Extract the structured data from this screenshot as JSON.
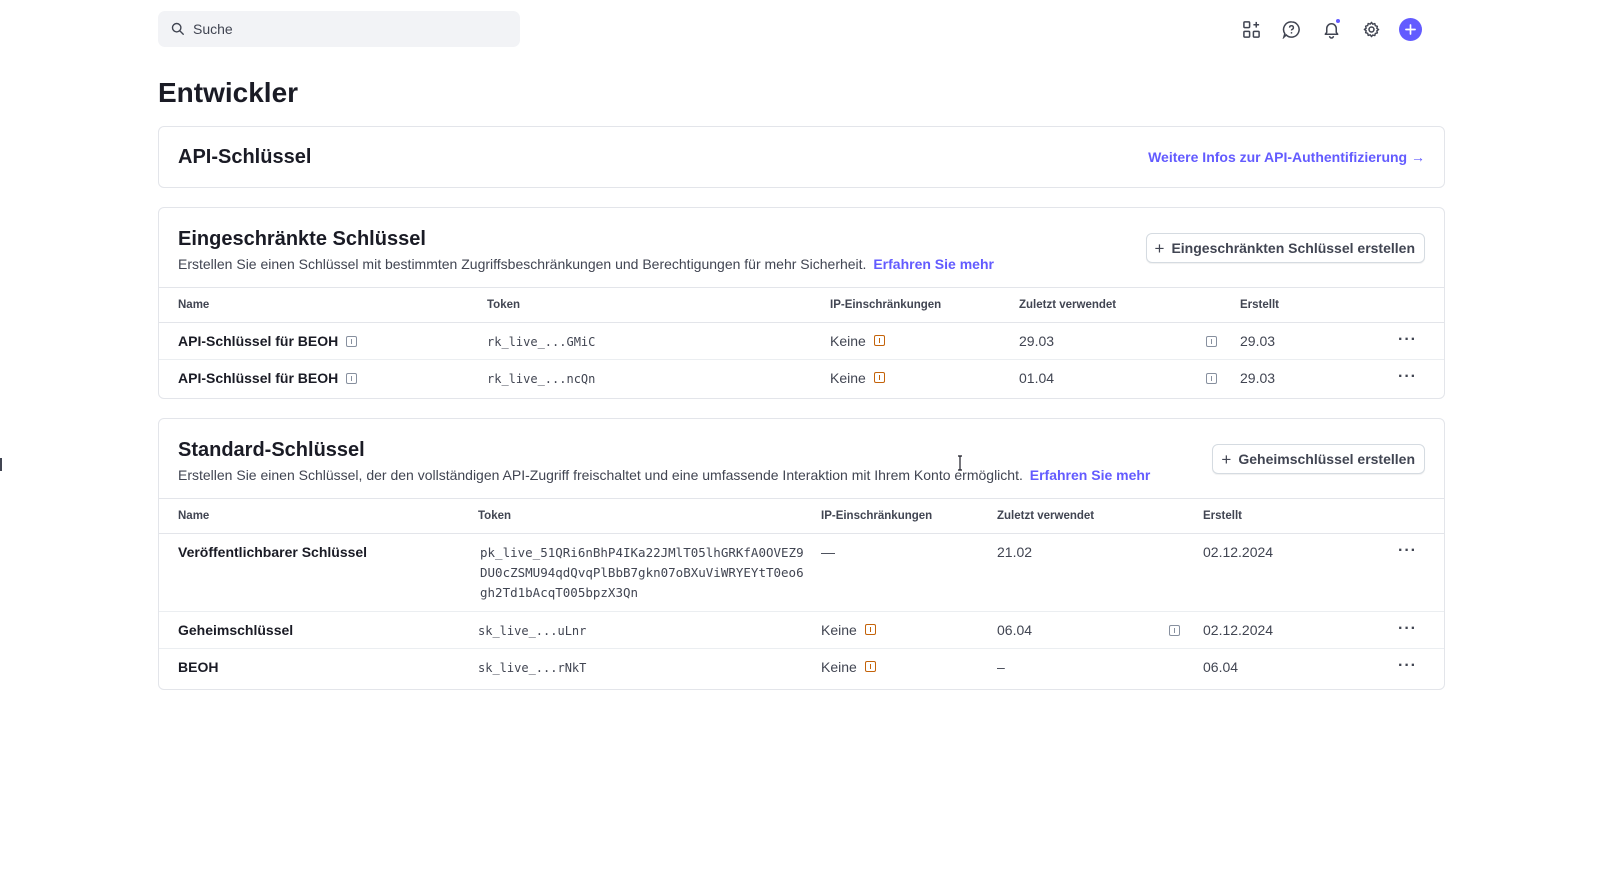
{
  "search": {
    "placeholder": "Suche",
    "icon": "search-icon"
  },
  "topbar": {
    "icons": [
      "apps-icon",
      "help-icon",
      "bell-icon",
      "gear-icon",
      "plus-icon"
    ],
    "accent": "#635bff"
  },
  "page": {
    "title": "Entwickler"
  },
  "api_card": {
    "title": "API-Schlüssel",
    "link": "Weitere Infos zur API-Authentifizierung →"
  },
  "restricted": {
    "title": "Eingeschränkte Schlüssel",
    "description": "Erstellen Sie einen Schlüssel mit bestimmten Zugriffsbeschränkungen und Berechtigungen für mehr Sicherheit.",
    "learn_more": "Erfahren Sie mehr",
    "create_button": "Eingeschränkten Schlüssel erstellen",
    "columns": [
      "Name",
      "Token",
      "IP-Einschränkungen",
      "Zuletzt verwendet",
      "Erstellt"
    ],
    "rows": [
      {
        "name": "API-Schlüssel für BEOH",
        "token": "rk_live_...GMiC",
        "ip": "Keine",
        "last_used": "29.03",
        "created": "29.03",
        "more": "···"
      },
      {
        "name": "API-Schlüssel für BEOH",
        "token": "rk_live_...ncQn",
        "ip": "Keine",
        "last_used": "01.04",
        "created": "29.03",
        "more": "···"
      }
    ]
  },
  "standard": {
    "title": "Standard-Schlüssel",
    "description": "Erstellen Sie einen Schlüssel, der den vollständigen API-Zugriff freischaltet und eine umfassende Interaktion mit Ihrem Konto ermöglicht.",
    "learn_more": "Erfahren Sie mehr",
    "create_button": "Geheimschlüssel erstellen",
    "columns": [
      "Name",
      "Token",
      "IP-Einschränkungen",
      "Zuletzt verwendet",
      "Erstellt"
    ],
    "rows": [
      {
        "name": "Veröffentlichbarer Schlüssel",
        "token": "pk_live_51QRi6nBhP4IKa22JMlT05lhGRKfA0OVEZ9DU0cZSMU94qdQvqPlBbB7gkn07oBXuViWRYEYtT0eo6gh2Td1bAcqT005bpzX3Qn",
        "ip": "—",
        "last_used": "21.02",
        "created": "02.12.2024",
        "more": "···"
      },
      {
        "name": "Geheimschlüssel",
        "token": "sk_live_...uLnr",
        "ip": "Keine",
        "last_used": "06.04",
        "created": "02.12.2024",
        "more": "···"
      },
      {
        "name": "BEOH",
        "token": "sk_live_...rNkT",
        "ip": "Keine",
        "last_used": "–",
        "created": "06.04",
        "more": "···"
      }
    ]
  }
}
